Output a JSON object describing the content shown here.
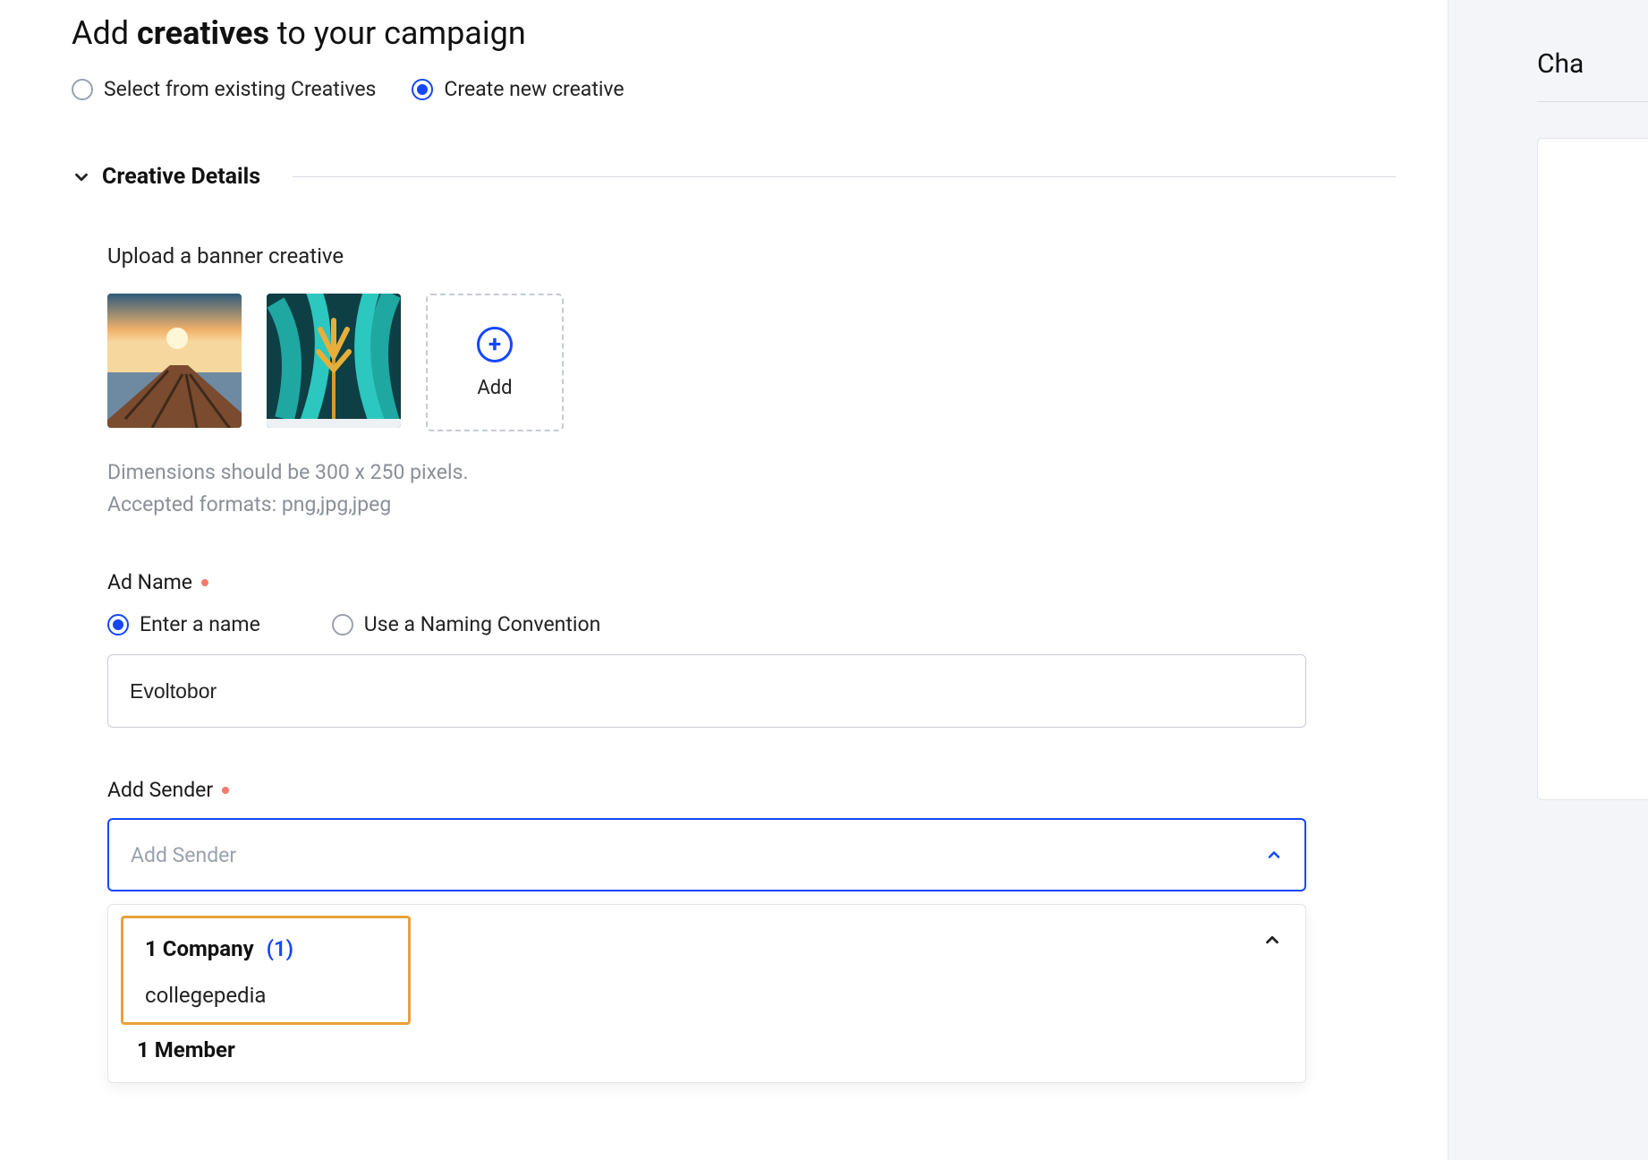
{
  "page": {
    "title_prefix": "Add ",
    "title_bold": "creatives",
    "title_suffix": " to your campaign"
  },
  "sourceRadios": {
    "existing": "Select from existing Creatives",
    "createNew": "Create new creative"
  },
  "section": {
    "title": "Creative Details"
  },
  "upload": {
    "label": "Upload a banner creative",
    "add": "Add",
    "hintLine1": "Dimensions should be 300 x 250 pixels.",
    "hintLine2": "Accepted formats: png,jpg,jpeg"
  },
  "adName": {
    "label": "Ad Name",
    "optEnter": "Enter a name",
    "optConvention": "Use a Naming Convention",
    "value": "Evoltobor"
  },
  "sender": {
    "label": "Add Sender",
    "placeholder": "Add Sender",
    "groups": [
      {
        "title": "1 Company",
        "count": "(1)",
        "items": [
          "collegepedia"
        ]
      }
    ],
    "memberHeader": "1 Member"
  },
  "rightPanel": {
    "title": "Cha"
  }
}
